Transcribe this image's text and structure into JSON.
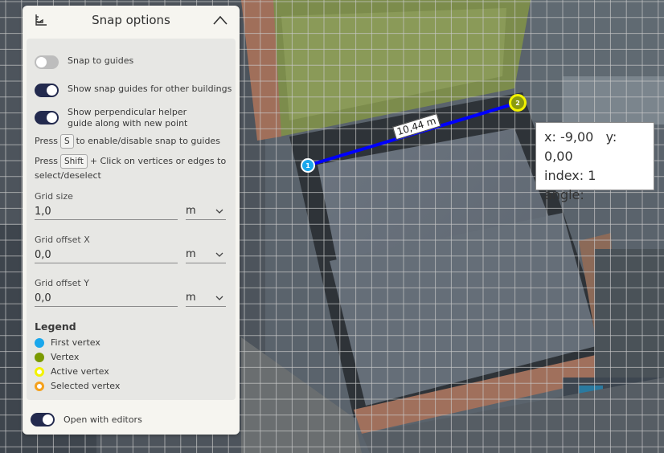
{
  "panel": {
    "title": "Snap options"
  },
  "options": {
    "snap_to_guides": {
      "label": "Snap to guides",
      "on": false
    },
    "show_snap_guides": {
      "label": "Show snap guides for other buildings",
      "on": true
    },
    "show_perpendicular": {
      "label": "Show perpendicular helper guide along with new point",
      "on": true
    }
  },
  "hints": {
    "snap_key": {
      "before": "Press",
      "key": "S",
      "after": "to enable/disable snap to guides"
    },
    "shift_key": {
      "before": "Press",
      "key": "Shift",
      "after": "+ Click on vertices or edges to select/deselect"
    }
  },
  "fields": {
    "grid_size": {
      "label": "Grid size",
      "value": "1,0",
      "unit": "m"
    },
    "offset_x": {
      "label": "Grid offset X",
      "value": "0,0",
      "unit": "m"
    },
    "offset_y": {
      "label": "Grid offset Y",
      "value": "0,0",
      "unit": "m"
    }
  },
  "legend": {
    "title": "Legend",
    "items": [
      {
        "label": "First vertex",
        "color": "#1aa7ec",
        "style": "fill"
      },
      {
        "label": "Vertex",
        "color": "#7a9a01",
        "style": "fill"
      },
      {
        "label": "Active vertex",
        "color": "#f3f300",
        "style": "ring"
      },
      {
        "label": "Selected vertex",
        "color": "#f5a11c",
        "style": "ring"
      }
    ]
  },
  "footer": {
    "open_with_editors": {
      "label": "Open with editors",
      "on": true
    }
  },
  "map": {
    "vertex_1_label": "1",
    "vertex_2_label": "2",
    "line_color": "#0000ff",
    "measurement": "10,44 m",
    "coords": {
      "x": "x: -9,00",
      "y": "y: 0,00",
      "index": "index: 1",
      "angle": "angle:"
    }
  },
  "colors": {
    "first_vertex": "#1aa7ec",
    "active_vertex": "#f3f300",
    "toggle_on": "#232a4e"
  }
}
